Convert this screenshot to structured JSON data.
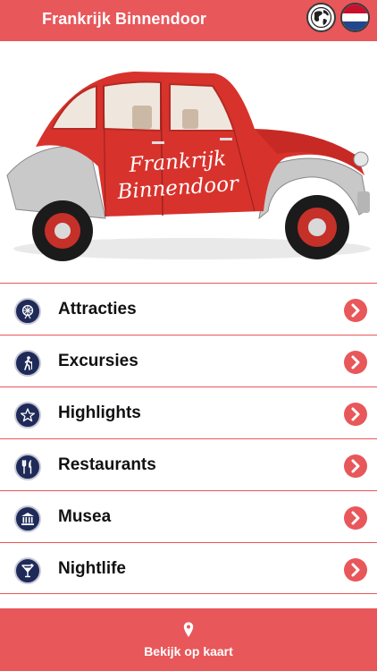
{
  "header": {
    "title": "Frankrijk Binnendoor",
    "globe_icon": "globe-icon",
    "flag_icon": "netherlands-flag-icon"
  },
  "hero": {
    "car_text_line1": "Frankrijk",
    "car_text_line2": "Binnendoor"
  },
  "menu": {
    "items": [
      {
        "label": "Attracties",
        "icon": "ferris-wheel-icon"
      },
      {
        "label": "Excursies",
        "icon": "hiker-icon"
      },
      {
        "label": "Highlights",
        "icon": "star-icon"
      },
      {
        "label": "Restaurants",
        "icon": "cutlery-icon"
      },
      {
        "label": "Musea",
        "icon": "museum-icon"
      },
      {
        "label": "Nightlife",
        "icon": "cocktail-icon"
      }
    ]
  },
  "footer": {
    "label": "Bekijk op kaart",
    "icon": "map-pin-icon"
  },
  "colors": {
    "accent": "#e8575a",
    "icon_bg": "#1f2a59",
    "car_red": "#d8322c"
  }
}
